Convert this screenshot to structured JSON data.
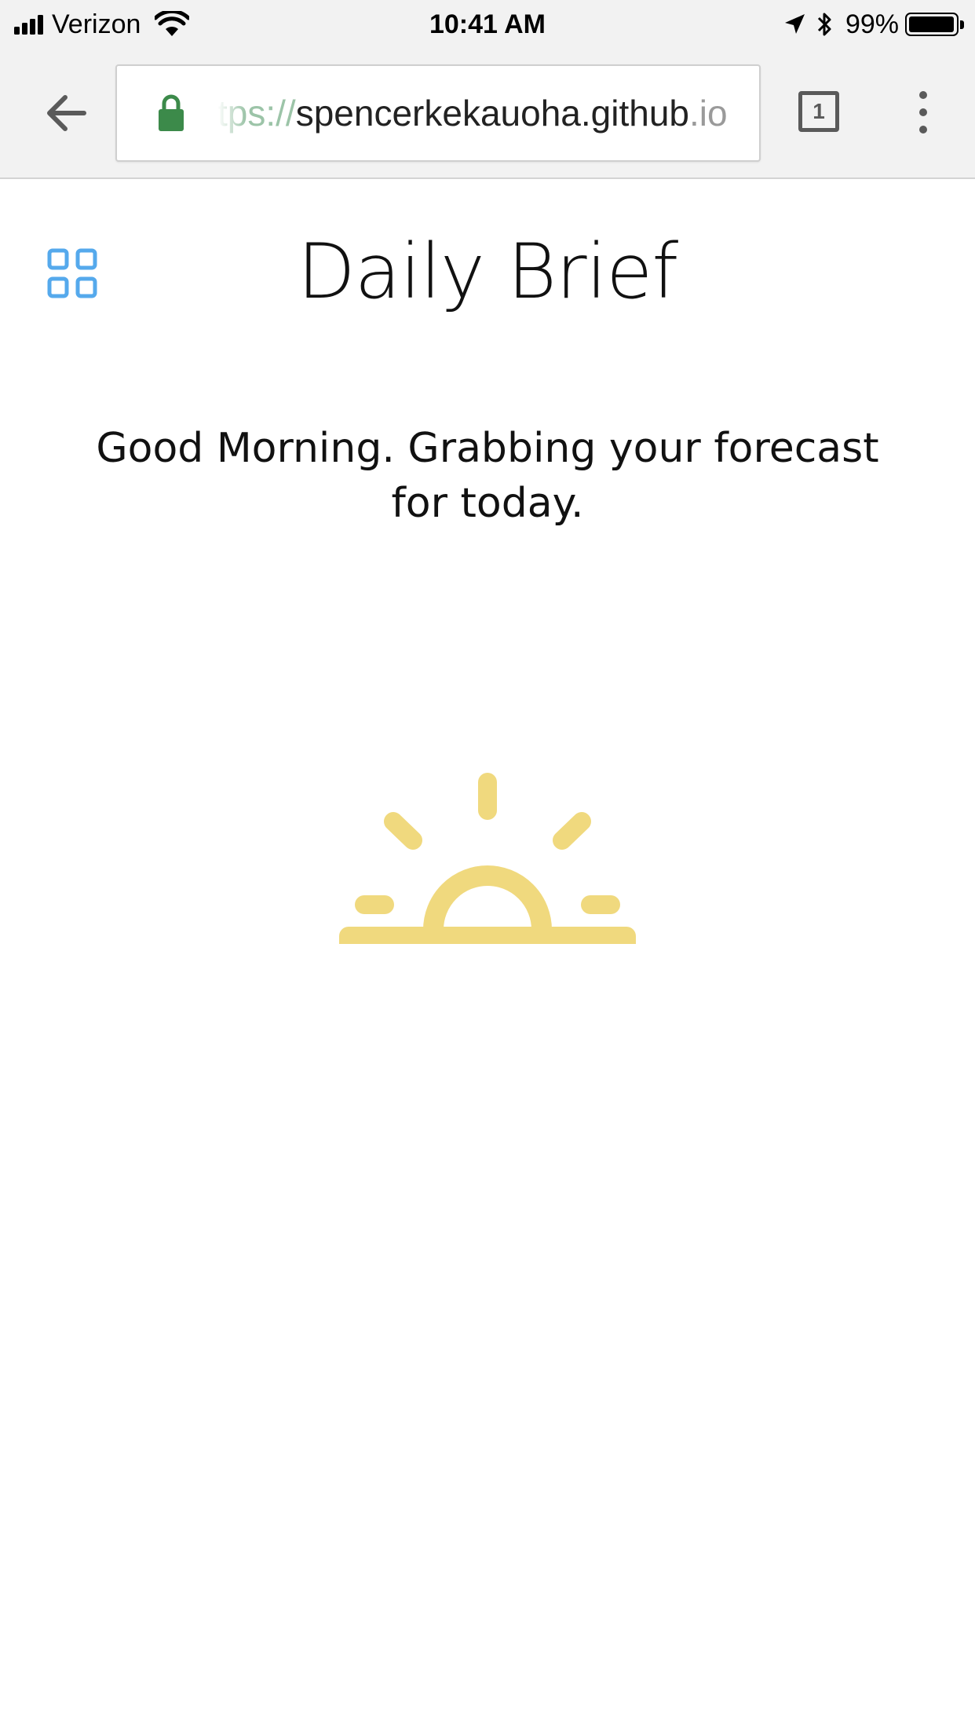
{
  "status_bar": {
    "carrier": "Verizon",
    "time": "10:41 AM",
    "battery_percent": "99%",
    "battery_level": 0.99,
    "signal_bars": 4
  },
  "browser": {
    "url_scheme": "tps://",
    "url_host": "spencerkekauoha.github",
    "url_tail": ".io",
    "tab_count": "1",
    "icons": [
      "back-arrow-icon",
      "lock-icon",
      "tab-switcher-icon",
      "more-menu-icon"
    ]
  },
  "page": {
    "title": "Daily Brief",
    "greeting": "Good Morning. Grabbing your forecast for today.",
    "menu_icon": "grid-icon",
    "illustration": "sunrise-icon"
  },
  "colors": {
    "accent_blue": "#55a9ec",
    "sun_yellow": "#f0d97e",
    "lock_green": "#3c8a4a"
  }
}
